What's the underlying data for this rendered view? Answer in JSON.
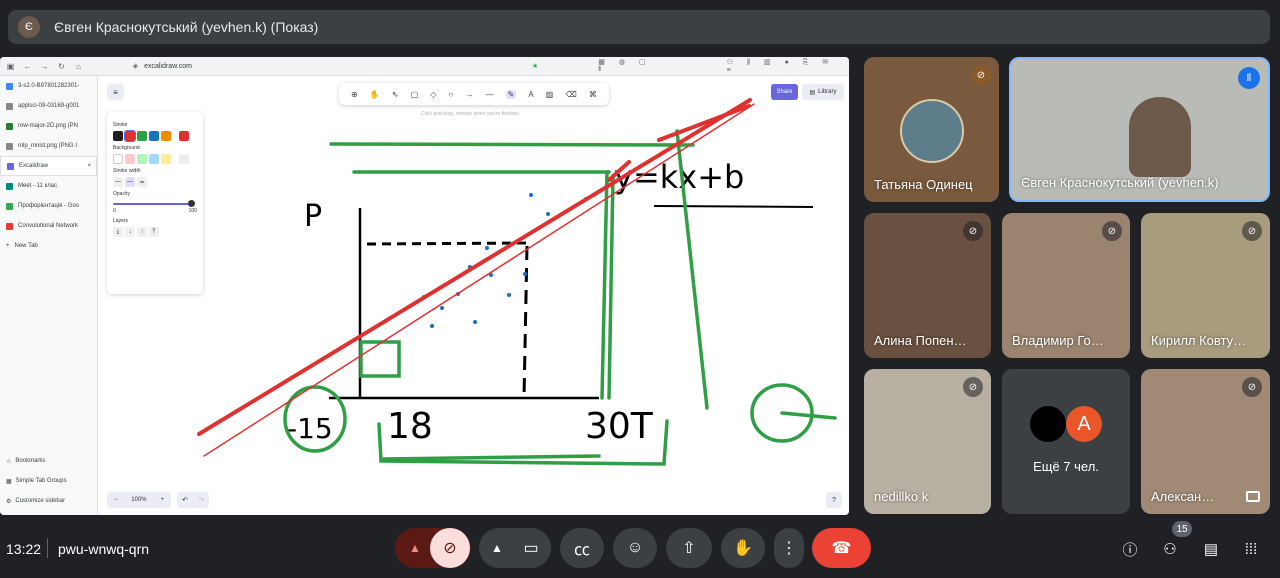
{
  "presenter_bar": {
    "avatar_letter": "Є",
    "title": "Євген Краснокутський (yevhen.k) (Показ)"
  },
  "browser": {
    "url": "excalidraw.com",
    "tabs": [
      {
        "label": "3-s2.0-B97801282301-"
      },
      {
        "label": "applsci-09-03169-g001"
      },
      {
        "label": "row-major-2D.png (PN"
      },
      {
        "label": "mlp_mnist.png (PNG I"
      },
      {
        "label": "Excalidraw",
        "close": "×"
      },
      {
        "label": "Meet - 11 клас"
      },
      {
        "label": "Профорієнтація - Goo"
      },
      {
        "label": "Convolutional Network"
      }
    ],
    "new_tab": "New Tab",
    "bottom_items": [
      "Bookmarks",
      "Simple Tab Groups",
      "Customize sidebar"
    ]
  },
  "excalidraw": {
    "hint": "Click and drag, release when you're finished",
    "share": "Share",
    "library": "Library",
    "props": {
      "stroke": "Stroke",
      "background": "Background",
      "stroke_width": "Stroke width",
      "opacity": "Opacity",
      "opacity_min": "0",
      "opacity_max": "100",
      "layers": "Layers"
    },
    "zoom": "100%",
    "zoom_minus": "−",
    "zoom_plus": "+"
  },
  "participants": [
    {
      "name": "Татьяна Одинец"
    },
    {
      "name": "Євген Краснокутський (yevhen.k)"
    },
    {
      "name": "Алина Попен…"
    },
    {
      "name": "Владимир Го…"
    },
    {
      "name": "Кирилл Ковту…"
    },
    {
      "name": "nedillko k"
    },
    {
      "name": "Ещё 7 чел.",
      "avatar_letter": "A"
    },
    {
      "name": "Алексан…"
    }
  ],
  "bottom_bar": {
    "time": "13:22",
    "meeting_code": "pwu-wnwq-qrn",
    "people_count": "15"
  },
  "colors": {
    "accent": "#6965db",
    "end_call": "#ea4335",
    "mic_off": "#f9dedc",
    "speaker": "#1a73e8"
  }
}
